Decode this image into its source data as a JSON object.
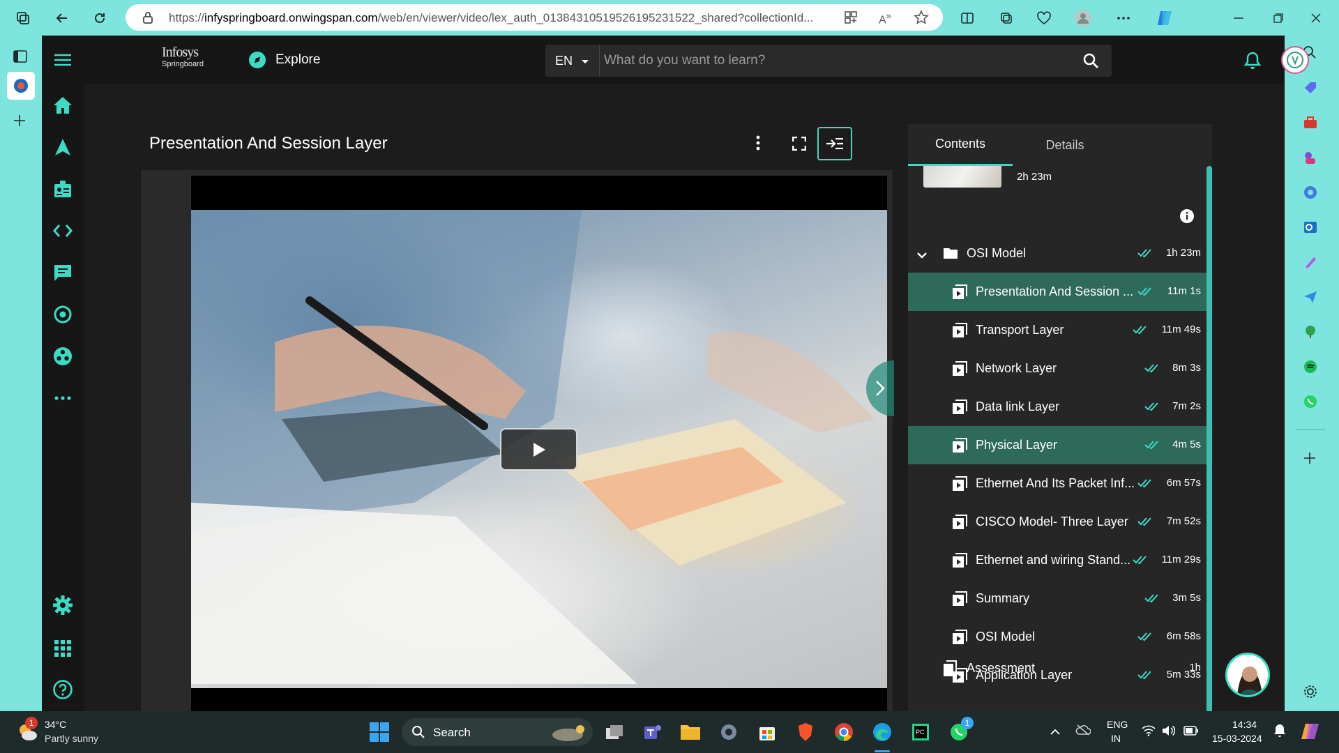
{
  "browser": {
    "url_prefix": "https://",
    "url_domain": "infyspringboard.onwingspan.com",
    "url_path": "/web/en/viewer/video/lex_auth_01384310519526195231522_shared?collectionId..."
  },
  "app": {
    "logo_line1": "Infosys",
    "logo_line2": "Springboard",
    "explore_label": "Explore",
    "language": "EN",
    "search_placeholder": "What do you want to learn?"
  },
  "viewer": {
    "title": "Presentation And Session Layer"
  },
  "panel": {
    "tabs": [
      "Contents",
      "Details"
    ],
    "top_item_duration": "2h 23m",
    "module": {
      "label": "OSI Model",
      "duration": "1h 23m"
    },
    "items": [
      {
        "label": "Presentation And Session ...",
        "duration": "11m 1s",
        "active": true
      },
      {
        "label": "Transport Layer",
        "duration": "11m 49s",
        "active": false
      },
      {
        "label": "Network Layer",
        "duration": "8m 3s",
        "active": false
      },
      {
        "label": "Data link Layer",
        "duration": "7m 2s",
        "active": false
      },
      {
        "label": "Physical Layer",
        "duration": "4m 5s",
        "active": true
      },
      {
        "label": "Ethernet And Its Packet Inf...",
        "duration": "6m 57s",
        "active": false
      },
      {
        "label": "CISCO Model- Three Layer",
        "duration": "7m 52s",
        "active": false
      },
      {
        "label": "Ethernet and wiring Stand...",
        "duration": "11m 29s",
        "active": false
      },
      {
        "label": "Summary",
        "duration": "3m 5s",
        "active": false
      },
      {
        "label": "OSI Model",
        "duration": "6m 58s",
        "active": false
      },
      {
        "label": "Application Layer",
        "duration": "5m 33s",
        "active": false
      }
    ],
    "assessment": {
      "label": "Assessment",
      "duration": "1h"
    }
  },
  "taskbar": {
    "weather_temp": "34°C",
    "weather_desc": "Partly sunny",
    "weather_badge": "1",
    "search_label": "Search",
    "lang_line1": "ENG",
    "lang_line2": "IN",
    "time": "14:34",
    "date": "15-03-2024",
    "whatsapp_badge": "1"
  },
  "colors": {
    "accent": "#3cdcc4",
    "active_row": "#2e6a5a",
    "browser_frame": "#7ee4de"
  }
}
